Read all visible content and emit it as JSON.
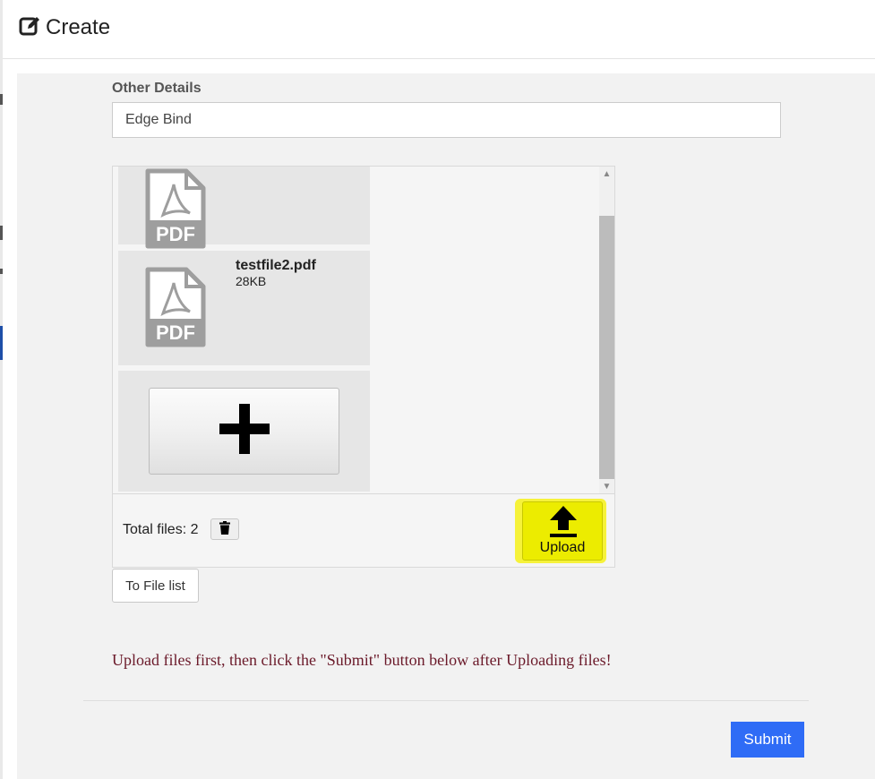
{
  "header": {
    "title": "Create",
    "icon": "edit-square-icon"
  },
  "form": {
    "other_details_label": "Other Details",
    "other_details_value": "Edge Bind"
  },
  "uploader": {
    "files": [
      {
        "name": "",
        "size": "",
        "icon": "pdf-icon"
      },
      {
        "name": "testfile2.pdf",
        "size": "28KB",
        "icon": "pdf-icon"
      }
    ],
    "pdf_icon_text": "PDF",
    "add_icon": "plus-icon",
    "total_files_label": "Total files: 2",
    "delete_icon": "trash-icon",
    "upload_label": "Upload",
    "upload_icon": "upload-arrow-icon",
    "highlight_color": "#f6f23a"
  },
  "buttons": {
    "to_file_list": "To File list",
    "submit": "Submit"
  },
  "notice": "Upload files first, then click the \"Submit\" button below after Uploading files!",
  "colors": {
    "submit_bg": "#2f6cf6",
    "notice_text": "#6b1a2a",
    "panel_bg": "#f2f2f2"
  }
}
